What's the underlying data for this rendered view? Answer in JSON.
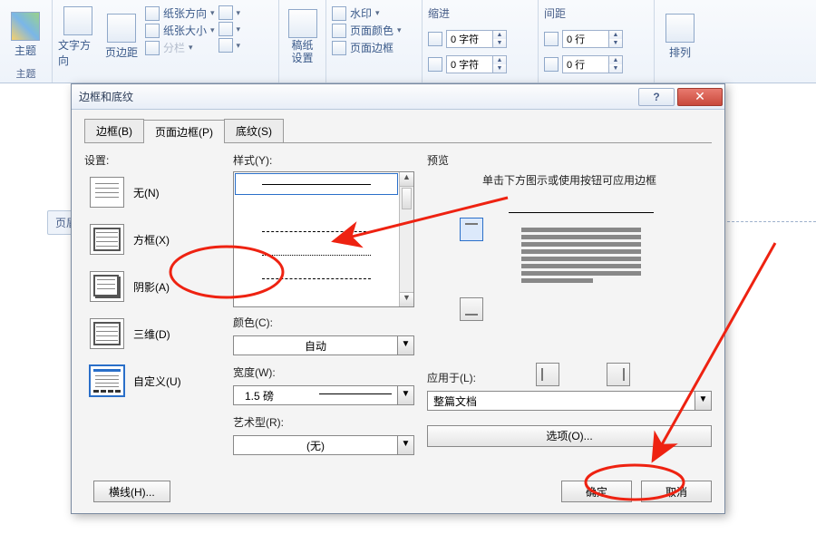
{
  "ribbon": {
    "theme_label": "主题",
    "text_dir": "文字方向",
    "margins": "页边距",
    "orientation": "纸张方向",
    "size": "纸张大小",
    "columns": "分栏",
    "draft_setup": "稿纸\n设置",
    "watermark": "水印",
    "page_color": "页面颜色",
    "page_border": "页面边框",
    "indent_label": "缩进",
    "spacing_label": "间距",
    "indent_left": "0 字符",
    "indent_right": "0 字符",
    "spacing_before": "0 行",
    "spacing_after": "0 行",
    "arrange": "排列"
  },
  "doc": {
    "header_tab": "页眉"
  },
  "dialog": {
    "title": "边框和底纹",
    "tabs": {
      "border": "边框(B)",
      "page_border": "页面边框(P)",
      "shading": "底纹(S)"
    },
    "settings_label": "设置:",
    "settings": {
      "none": "无(N)",
      "box": "方框(X)",
      "shadow": "阴影(A)",
      "threeD": "三维(D)",
      "custom": "自定义(U)"
    },
    "style_label": "样式(Y):",
    "color_label": "颜色(C):",
    "color_value": "自动",
    "width_label": "宽度(W):",
    "width_value": "1.5 磅",
    "art_label": "艺术型(R):",
    "art_value": "(无)",
    "preview_label": "预览",
    "preview_hint": "单击下方图示或使用按钮可应用边框",
    "apply_label": "应用于(L):",
    "apply_value": "整篇文档",
    "options": "选项(O)...",
    "hline": "横线(H)...",
    "ok": "确定",
    "cancel": "取消"
  }
}
